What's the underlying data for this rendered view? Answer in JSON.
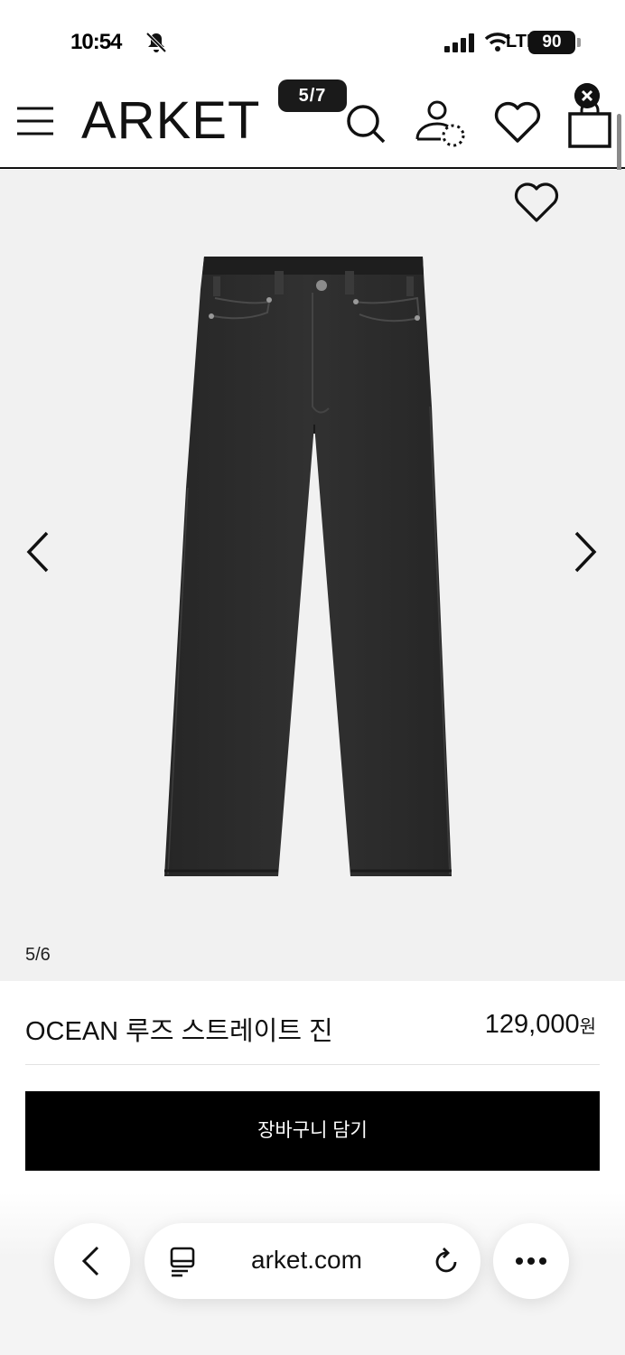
{
  "status_bar": {
    "time": "10:54",
    "carrier": "LTE",
    "battery": "90"
  },
  "header": {
    "logo": "ARKET",
    "page_indicator": "5/7",
    "icons": [
      "hamburger-menu-icon",
      "search-icon",
      "account-icon",
      "wishlist-heart-icon",
      "shopping-bag-icon",
      "close-icon"
    ]
  },
  "gallery": {
    "counter": "5/6",
    "icons": [
      "heart-icon",
      "chevron-left-icon",
      "chevron-right-icon"
    ]
  },
  "product": {
    "name": "OCEAN 루즈 스트레이트 진",
    "price": "129,000",
    "currency": "원",
    "add_to_cart_label": "장바구니 담기"
  },
  "browser": {
    "url": "arket.com",
    "icons": [
      "back-icon",
      "tabs-icon",
      "reload-icon",
      "more-icon"
    ]
  },
  "colors": {
    "accent": "#000000",
    "gallery_background": "#f1f1f1",
    "denim": "#2b2b2b"
  }
}
